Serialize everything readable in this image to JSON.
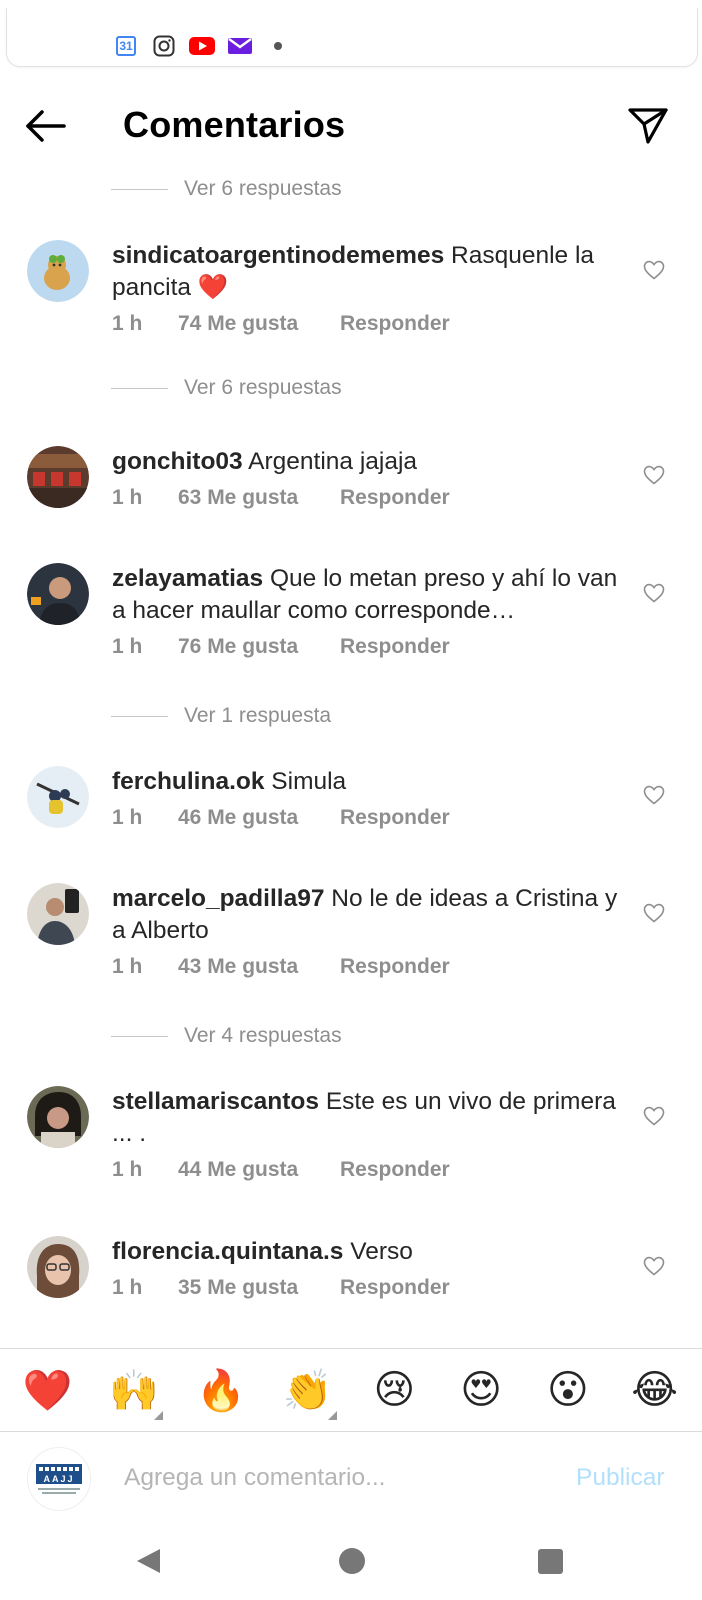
{
  "status_bar": {
    "calendar_day": "31",
    "icons": [
      "calendar-icon",
      "instagram-icon",
      "youtube-icon",
      "mail-icon",
      "notification-dot-icon"
    ]
  },
  "header": {
    "title": "Comentarios"
  },
  "replies_toggles": [
    {
      "label": "Ver 6 respuestas"
    },
    {
      "label": "Ver 6 respuestas"
    },
    {
      "label": "Ver 1 respuesta"
    },
    {
      "label": "Ver 4 respuestas"
    }
  ],
  "comments": [
    {
      "username": "sindicatoargentinodememes",
      "text": "Rasquenle la pancita",
      "emoji": "❤️",
      "time": "1 h",
      "likes": "74 Me gusta",
      "reply": "Responder"
    },
    {
      "username": "gonchito03",
      "text": "Argentina jajaja",
      "time": "1 h",
      "likes": "63 Me gusta",
      "reply": "Responder"
    },
    {
      "username": "zelayamatias",
      "text": "Que lo metan preso y ahí lo van a hacer maullar como corresponde…",
      "time": "1 h",
      "likes": "76 Me gusta",
      "reply": "Responder"
    },
    {
      "username": "ferchulina.ok",
      "text": "Simula",
      "time": "1 h",
      "likes": "46 Me gusta",
      "reply": "Responder"
    },
    {
      "username": "marcelo_padilla97",
      "text": "No le de ideas a Cristina y a Alberto",
      "time": "1 h",
      "likes": "43 Me gusta",
      "reply": "Responder"
    },
    {
      "username": "stellamariscantos",
      "text": "Este es un vivo de primera ... .",
      "time": "1 h",
      "likes": "44 Me gusta",
      "reply": "Responder"
    },
    {
      "username": "florencia.quintana.s",
      "text": "Verso",
      "time": "1 h",
      "likes": "35 Me gusta",
      "reply": "Responder"
    }
  ],
  "emoji_bar": [
    "❤️",
    "🙌",
    "🔥",
    "👏",
    "😢",
    "😍",
    "😮",
    "😂"
  ],
  "composer": {
    "placeholder": "Agrega un comentario...",
    "publish_label": "Publicar",
    "avatar_text": "AAJJ"
  },
  "colors": {
    "text": "#262626",
    "secondary": "#8e8e8e",
    "publish_disabled": "#b2dffc",
    "heart": "#e0245e"
  }
}
